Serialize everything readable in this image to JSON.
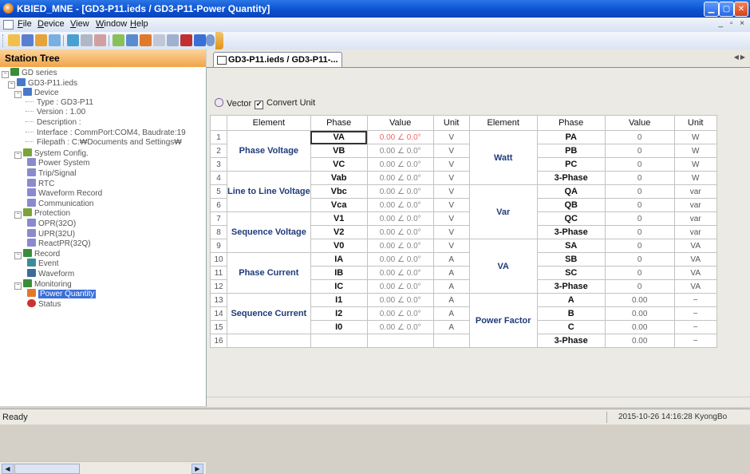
{
  "window": {
    "title": "KBIED_MNE - [GD3-P11.ieds / GD3-P11-Power Quantity]"
  },
  "menu": [
    {
      "u": "F",
      "rest": "ile"
    },
    {
      "u": "D",
      "rest": "evice"
    },
    {
      "u": "V",
      "rest": "iew"
    },
    {
      "u": "W",
      "rest": "indow"
    },
    {
      "u": "H",
      "rest": "elp"
    }
  ],
  "station": {
    "title": "Station Tree",
    "tree": [
      {
        "label": "GD series",
        "level": 0,
        "exp": "−",
        "icon": "device-series-icon",
        "color": "#3a8c3a"
      },
      {
        "label": "GD3-P11.ieds",
        "level": 1,
        "exp": "−",
        "icon": "ieds-file-icon",
        "color": "#4a78c8"
      },
      {
        "label": "Device",
        "level": 2,
        "exp": "−",
        "icon": "device-icon",
        "color": "#4a78c8"
      },
      {
        "label": "Type : GD3-P11",
        "level": 3
      },
      {
        "label": "Version : 1.00",
        "level": 3
      },
      {
        "label": "Description :",
        "level": 3
      },
      {
        "label": "Interface : CommPort:COM4, Baudrate:19",
        "level": 3
      },
      {
        "label": "Filepath : C:₩Documents and Settings₩",
        "level": 3
      },
      {
        "label": "System Config.",
        "level": 2,
        "exp": "−",
        "icon": "system-config-icon",
        "color": "#7aa43a"
      },
      {
        "label": "Power System",
        "level": 3,
        "icon": "settings-page-icon",
        "color": "#8a8ad0"
      },
      {
        "label": "Trip/Signal",
        "level": 3,
        "icon": "settings-page-icon",
        "color": "#8a8ad0"
      },
      {
        "label": "RTC",
        "level": 3,
        "icon": "settings-page-icon",
        "color": "#8a8ad0"
      },
      {
        "label": "Waveform Record",
        "level": 3,
        "icon": "settings-page-icon",
        "color": "#8a8ad0"
      },
      {
        "label": "Communication",
        "level": 3,
        "icon": "settings-page-icon",
        "color": "#8a8ad0"
      },
      {
        "label": "Protection",
        "level": 2,
        "exp": "−",
        "icon": "protection-icon",
        "color": "#7aa43a"
      },
      {
        "label": "OPR(32O)",
        "level": 3,
        "icon": "settings-page-icon",
        "color": "#8a8ad0"
      },
      {
        "label": "UPR(32U)",
        "level": 3,
        "icon": "settings-page-icon",
        "color": "#8a8ad0"
      },
      {
        "label": "ReactPR(32Q)",
        "level": 3,
        "icon": "settings-page-icon",
        "color": "#8a8ad0"
      },
      {
        "label": "Record",
        "level": 2,
        "exp": "−",
        "icon": "record-icon",
        "color": "#3a8c3a"
      },
      {
        "label": "Event",
        "level": 3,
        "icon": "event-icon",
        "color": "#3a8c9c"
      },
      {
        "label": "Waveform",
        "level": 3,
        "icon": "waveform-icon",
        "color": "#3a6c9c"
      },
      {
        "label": "Monitoring",
        "level": 2,
        "exp": "−",
        "icon": "monitoring-icon",
        "color": "#3a8c3a"
      },
      {
        "label": "Power Quantity",
        "level": 3,
        "icon": "power-quantity-icon",
        "color": "#e07a2a",
        "selected": true
      },
      {
        "label": "Status",
        "level": 3,
        "icon": "status-icon",
        "color": "#d03030"
      }
    ]
  },
  "document_tab": {
    "label": "GD3-P11.ieds / GD3-P11-..."
  },
  "options": {
    "vector": "Vector",
    "convert_unit": "Convert Unit",
    "convert_checked": "✔"
  },
  "table": {
    "headers": [
      "Element",
      "Phase",
      "Value",
      "Unit",
      "Element",
      "Phase",
      "Value",
      "Unit"
    ],
    "left_rows": [
      {
        "no": "1",
        "phase": "VA",
        "value": "0.00 ∠ 0.0°",
        "unit": "V"
      },
      {
        "no": "2",
        "phase": "VB",
        "value": "0.00 ∠ 0.0°",
        "unit": "V"
      },
      {
        "no": "3",
        "phase": "VC",
        "value": "0.00 ∠ 0.0°",
        "unit": "V"
      },
      {
        "no": "4",
        "phase": "Vab",
        "value": "0.00 ∠ 0.0°",
        "unit": "V"
      },
      {
        "no": "5",
        "phase": "Vbc",
        "value": "0.00 ∠ 0.0°",
        "unit": "V"
      },
      {
        "no": "6",
        "phase": "Vca",
        "value": "0.00 ∠ 0.0°",
        "unit": "V"
      },
      {
        "no": "7",
        "phase": "V1",
        "value": "0.00 ∠ 0.0°",
        "unit": "V"
      },
      {
        "no": "8",
        "phase": "V2",
        "value": "0.00 ∠ 0.0°",
        "unit": "V"
      },
      {
        "no": "9",
        "phase": "V0",
        "value": "0.00 ∠ 0.0°",
        "unit": "V"
      },
      {
        "no": "10",
        "phase": "IA",
        "value": "0.00 ∠ 0.0°",
        "unit": "A"
      },
      {
        "no": "11",
        "phase": "IB",
        "value": "0.00 ∠ 0.0°",
        "unit": "A"
      },
      {
        "no": "12",
        "phase": "IC",
        "value": "0.00 ∠ 0.0°",
        "unit": "A"
      },
      {
        "no": "13",
        "phase": "I1",
        "value": "0.00 ∠ 0.0°",
        "unit": "A"
      },
      {
        "no": "14",
        "phase": "I2",
        "value": "0.00 ∠ 0.0°",
        "unit": "A"
      },
      {
        "no": "15",
        "phase": "I0",
        "value": "0.00 ∠ 0.0°",
        "unit": "A"
      },
      {
        "no": "16",
        "phase": "",
        "value": "",
        "unit": ""
      }
    ],
    "left_groups": [
      {
        "label": "Phase Voltage",
        "start": 0,
        "span": 3
      },
      {
        "label": "Line to Line Voltage",
        "start": 3,
        "span": 3
      },
      {
        "label": "Sequence Voltage",
        "start": 6,
        "span": 3
      },
      {
        "label": "Phase Current",
        "start": 9,
        "span": 3
      },
      {
        "label": "Sequence Current",
        "start": 12,
        "span": 3
      },
      {
        "label": "",
        "start": 15,
        "span": 1
      }
    ],
    "right_rows": [
      {
        "phase": "PA",
        "value": "0",
        "unit": "W"
      },
      {
        "phase": "PB",
        "value": "0",
        "unit": "W"
      },
      {
        "phase": "PC",
        "value": "0",
        "unit": "W"
      },
      {
        "phase": "3-Phase",
        "value": "0",
        "unit": "W"
      },
      {
        "phase": "QA",
        "value": "0",
        "unit": "var"
      },
      {
        "phase": "QB",
        "value": "0",
        "unit": "var"
      },
      {
        "phase": "QC",
        "value": "0",
        "unit": "var"
      },
      {
        "phase": "3-Phase",
        "value": "0",
        "unit": "var"
      },
      {
        "phase": "SA",
        "value": "0",
        "unit": "VA"
      },
      {
        "phase": "SB",
        "value": "0",
        "unit": "VA"
      },
      {
        "phase": "SC",
        "value": "0",
        "unit": "VA"
      },
      {
        "phase": "3-Phase",
        "value": "0",
        "unit": "VA"
      },
      {
        "phase": "A",
        "value": "0.00",
        "unit": "−"
      },
      {
        "phase": "B",
        "value": "0.00",
        "unit": "−"
      },
      {
        "phase": "C",
        "value": "0.00",
        "unit": "−"
      },
      {
        "phase": "3-Phase",
        "value": "0.00",
        "unit": "−"
      }
    ],
    "right_groups": [
      {
        "label": "Watt",
        "start": 0,
        "span": 4
      },
      {
        "label": "Var",
        "start": 4,
        "span": 4
      },
      {
        "label": "VA",
        "start": 8,
        "span": 4
      },
      {
        "label": "Power Factor",
        "start": 12,
        "span": 4
      }
    ]
  },
  "status": {
    "ready": "Ready",
    "timestamp": "2015-10-26 14:16:28",
    "user": "KyongBo"
  }
}
